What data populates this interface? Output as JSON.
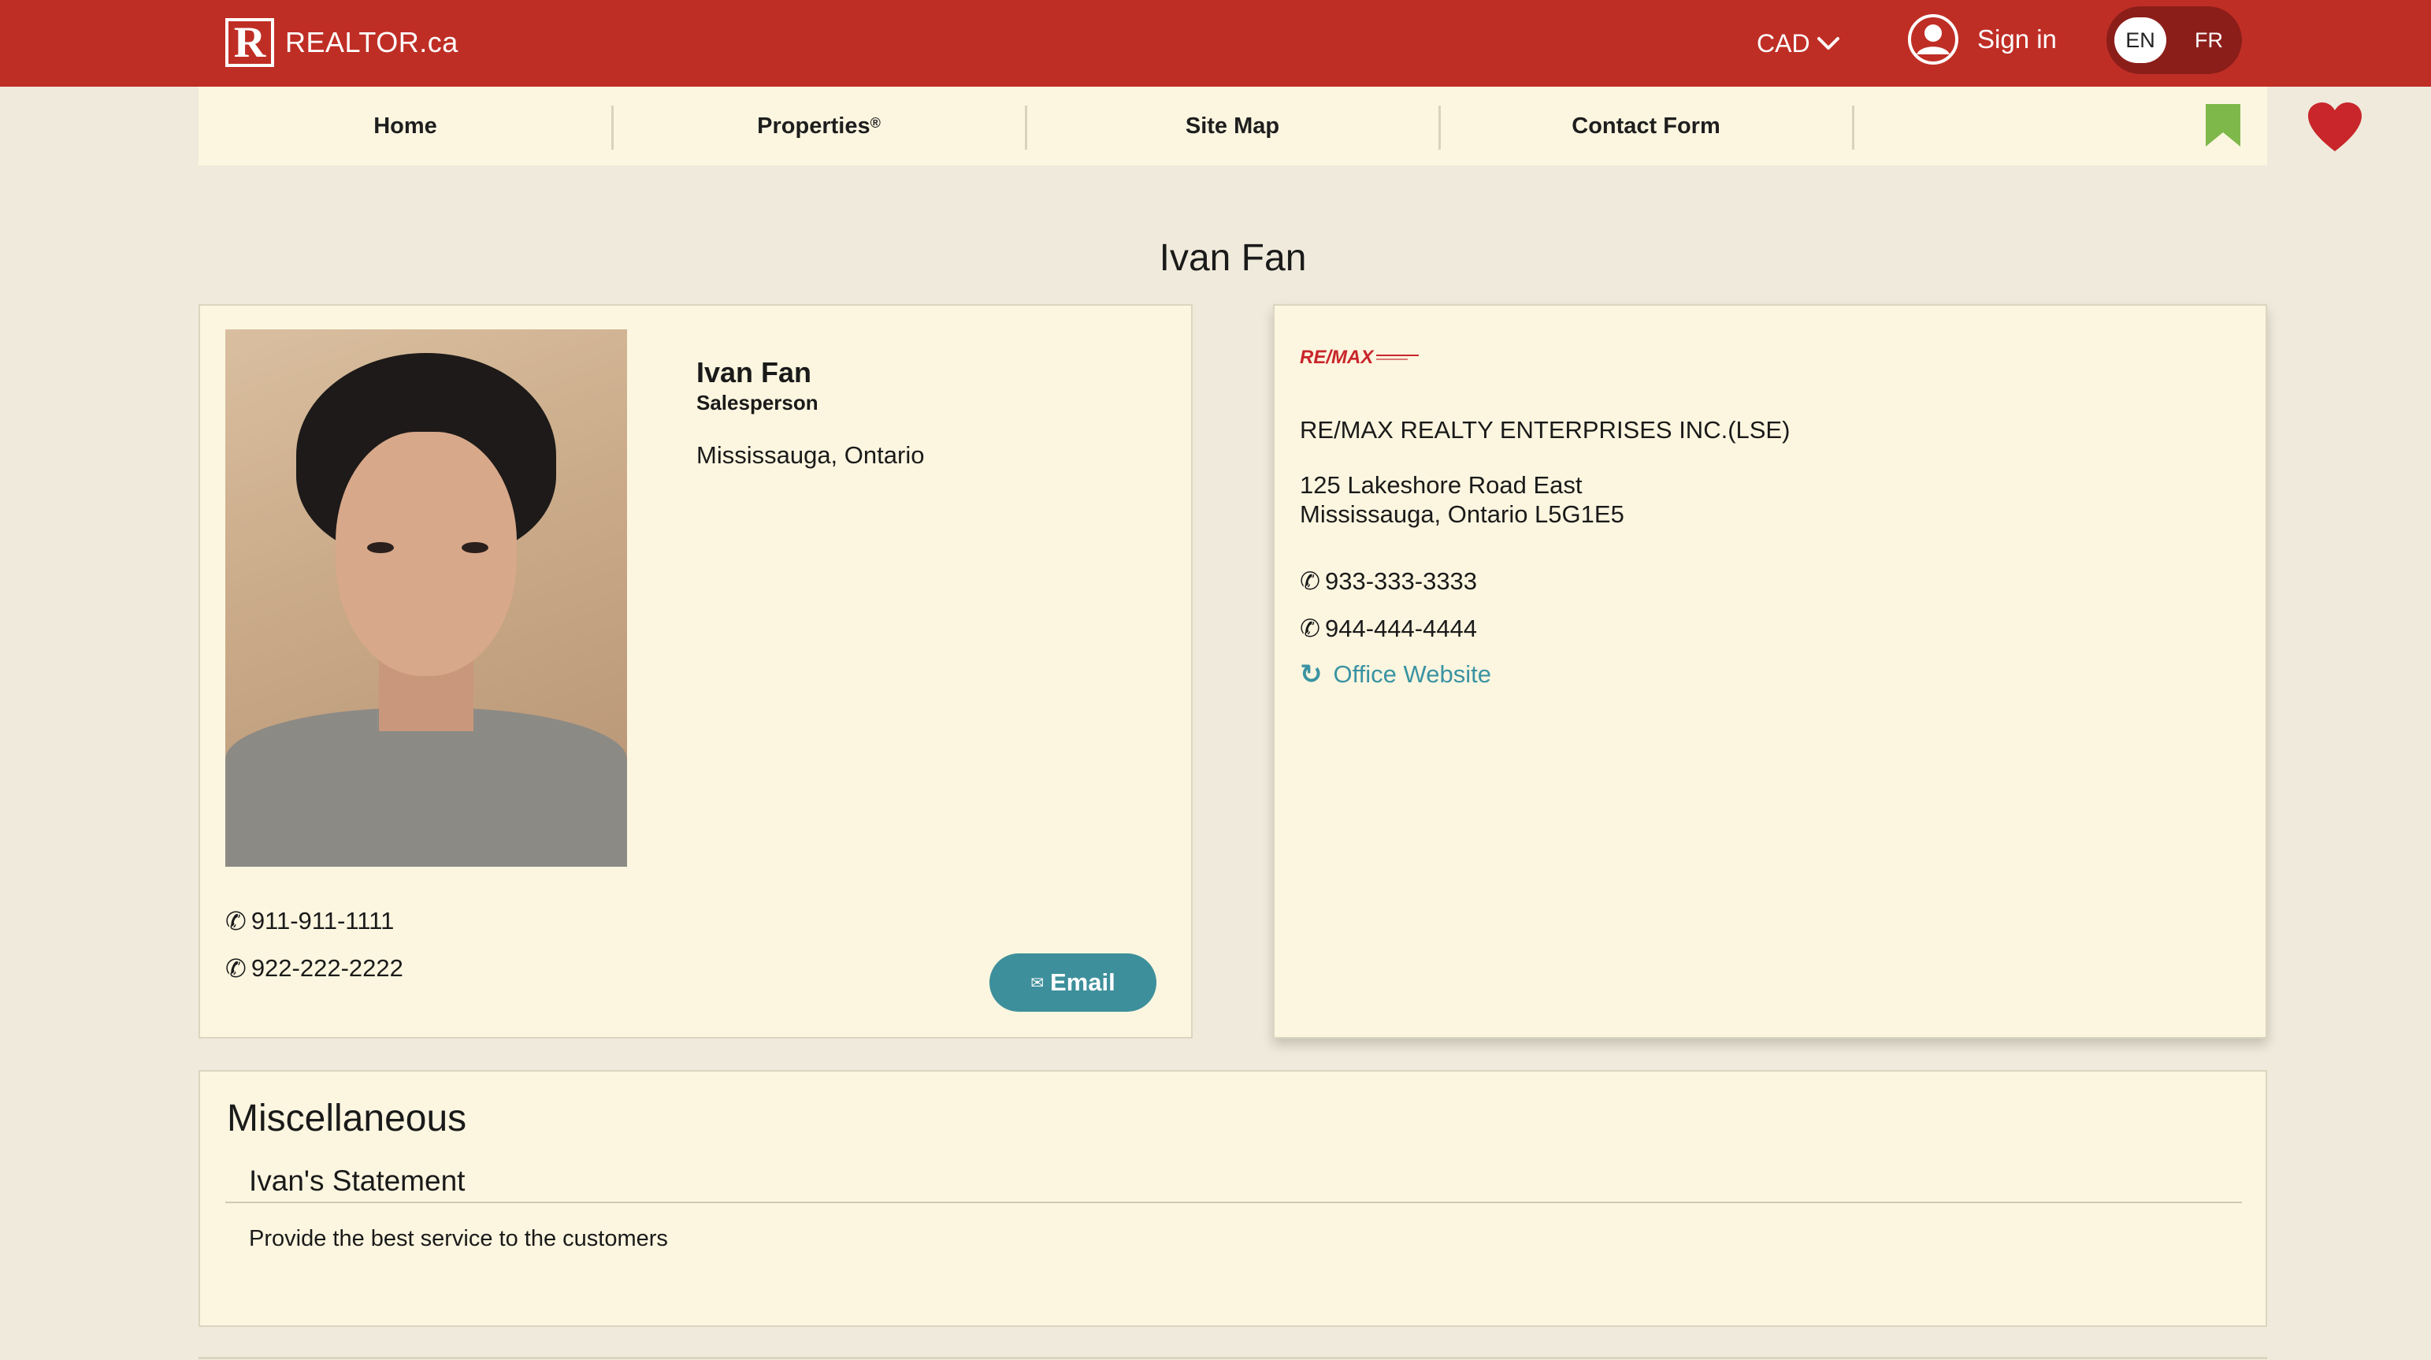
{
  "header": {
    "logo_text": "REALTOR.ca",
    "logo_mark": "R",
    "currency": "CAD",
    "sign_in": "Sign in",
    "lang_en": "EN",
    "lang_fr": "FR",
    "colors": {
      "brand": "#bf2e25",
      "toggle": "#8c1e1a"
    }
  },
  "nav": {
    "home": "Home",
    "properties": "Properties",
    "properties_mark": "®",
    "site_map": "Site Map",
    "contact_form": "Contact Form",
    "icons": [
      "bookmark-icon",
      "heart-icon"
    ]
  },
  "page": {
    "title": "Ivan Fan"
  },
  "agent": {
    "name": "Ivan Fan",
    "role": "Salesperson",
    "location": "Mississauga, Ontario",
    "phones": [
      "911-911-1111",
      "922-222-2222"
    ],
    "email_label": "Email",
    "phone_glyph": "✆",
    "mail_glyph": "✉"
  },
  "office": {
    "logo_text": "RE/MAX",
    "name": "RE/MAX REALTY ENTERPRISES INC.(LSE)",
    "address_line1": "125 Lakeshore Road East",
    "address_line2": "Mississauga, Ontario L5G1E5",
    "phones": [
      "933-333-3333",
      "944-444-4444"
    ],
    "website_label": "Office Website",
    "website_glyph": "↻",
    "link_color": "#3a93a3"
  },
  "misc": {
    "title": "Miscellaneous",
    "statement_heading": "Ivan's Statement",
    "statement_text": "Provide the best service to the customers"
  }
}
